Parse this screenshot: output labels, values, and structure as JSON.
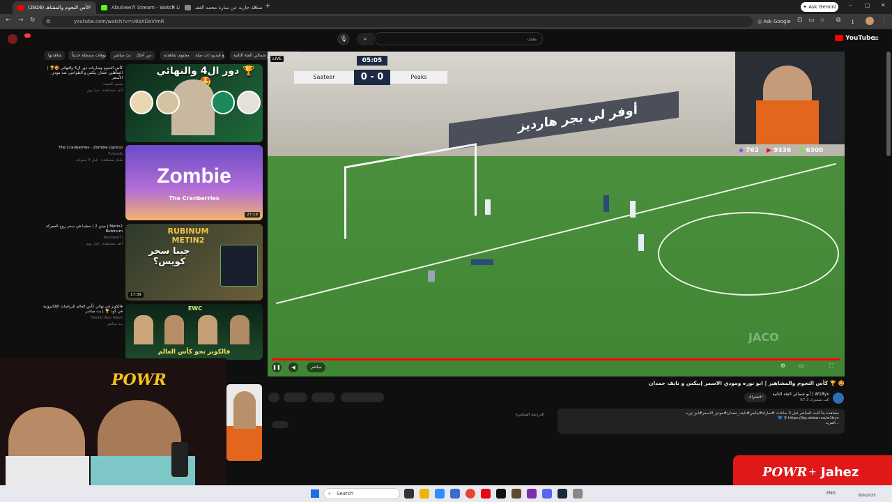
{
  "browser": {
    "tabs": [
      {
        "title": "(2926) كأس النجوم والمشاهـ",
        "active": true,
        "favicon_color": "#ff0000"
      },
      {
        "title": "AbuSwe7l Stream - Watch Live",
        "active": false,
        "favicon_color": "#53fc18"
      },
      {
        "title": "صدقة جارية عن سارة محمد الغفـ",
        "active": false,
        "favicon_color": "#888888"
      }
    ],
    "new_tab": "+",
    "ask_gemini": "Ask Gemini",
    "url": "youtube.com/watch?v=V8bXDoVlmR",
    "ask_google": "Ask Google"
  },
  "youtube": {
    "logo": "YouTube",
    "search_placeholder": "بحث",
    "search_value": "",
    "chips": [
      "من أبو شمالي الفئة الثانية | W1Byv",
      "مقاطع فيديو ذات صلة",
      "محتوى شاهدته",
      "من أجلك",
      "بث مباشر",
      "فيديوهات مسجلة حديثاً",
      "شاهدتها"
    ]
  },
  "recommendations": [
    {
      "title": "كأس النجوم ومباريات دور ال4 والنهائي 🤩🏆 | المتأهلين عشان بيكس و الطواجين ضد مودي الأسمر",
      "channel": "متمم الضيف",
      "meta": "ألف مشاهدة · منذ يوم",
      "thumb_text": "دور ال4 والنهائي 🏆🤩",
      "duration": ""
    },
    {
      "title": "The Cranberries - Zombie (Lyrics)",
      "channel": "7clouds",
      "meta": "مليار مشاهدة · قبل 4 سنوات",
      "thumb_text": "Zombie",
      "thumb_sub": "The Cranberries",
      "duration": "27:19"
    },
    {
      "title": "ميتن 2 | حطينا في سحر روح المعركة | Metin2 Rubinum",
      "channel": "AbuSwe7l",
      "meta": "ألف مشاهدة · قبل يوم",
      "thumb_text": "جبنا سحر كويس؟",
      "thumb_sub": "RUBINUM METIN2",
      "duration": "17:39"
    },
    {
      "title": "فالكونز في نهائي كأس العالم للرياضات الإلكترونية في كود 🏆 | بث مباشر",
      "channel": "Falcon Abu Nasir",
      "meta": "بث مباشر",
      "thumb_text": "فالكونز نحو كأس العالم",
      "thumb_sub": "EWC",
      "duration": ""
    }
  ],
  "player": {
    "live_badge": "LIVE",
    "team_home": "Saateer",
    "team_away": "Peaks",
    "score": "0 - 0",
    "clock": "05:05",
    "sponsor_board": "هارديز",
    "sponsor_board_2": "أوفر لي بجر",
    "watermark": "JACO",
    "live_label": "مباشر"
  },
  "stream_stats": {
    "twitch": "762",
    "youtube": "9336",
    "kick": "6300"
  },
  "video": {
    "title": "كأس النجوم والمشاهير | ابو نوره ومودي الاسمر إبيكس و نايف حمدان 🏆 🤩",
    "channel": "أبو شمالي الفئة الثانية | W1Byv",
    "subscribers": "67.3 ألف مشترك",
    "join": "الاشتراك",
    "description": "مشاهدة بدأ البث المباشر قبل 3 ساعات #مباراة#بيكس#نايف_حمدان#مودي_الاسمر#ابو_نوره\n💙 ♀ https://tip.dokan.sa/w1byv\nالمزيد...",
    "chat_label": "الدردشة المباشرة"
  },
  "overlay": {
    "brand_1": "POWR",
    "plus": "+",
    "brand_2": "Jahez"
  },
  "taskbar": {
    "search": "Search",
    "lang": "ENG",
    "time": "",
    "date": "8/9/2025"
  },
  "colors": {
    "youtube_red": "#ff0000",
    "pitch_green": "#3a7d3a",
    "brand_red": "#e01818",
    "kick_green": "#53fc18",
    "twitch_purple": "#9146ff"
  }
}
